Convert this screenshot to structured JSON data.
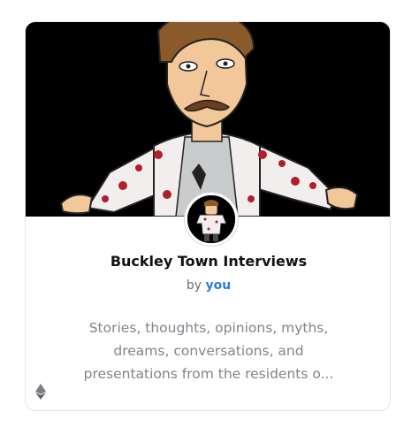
{
  "card": {
    "title": "Buckley Town Interviews",
    "by_prefix": "by",
    "author": "you",
    "description_lines": [
      "Stories, thoughts, opinions, myths,",
      "dreams, conversations, and",
      "presentations from the residents o..."
    ],
    "banner_image": "cartoon-character-shirt-banner",
    "avatar_image": "cartoon-character-avatar",
    "chain_icon": "ethereum-icon"
  },
  "colors": {
    "author_link": "#2c7be5",
    "banner_bg": "#000000",
    "title_text": "#111111",
    "description_text": "#80858c"
  }
}
